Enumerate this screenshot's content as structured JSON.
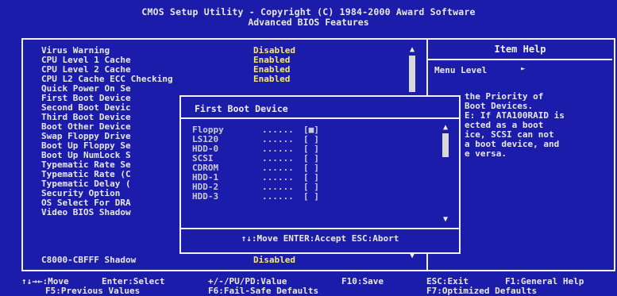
{
  "header": {
    "title": "CMOS Setup Utility - Copyright (C) 1984-2000 Award Software",
    "subtitle": "Advanced BIOS Features"
  },
  "settings": [
    {
      "name": "Virus Warning",
      "value": "Disabled"
    },
    {
      "name": "CPU Level 1 Cache",
      "value": "Enabled"
    },
    {
      "name": "CPU Level 2 Cache",
      "value": "Enabled"
    },
    {
      "name": "CPU L2 Cache ECC Checking",
      "value": "Enabled"
    },
    {
      "name": "Quick Power On Se",
      "value": ""
    },
    {
      "name": "First Boot Device",
      "value": ""
    },
    {
      "name": "Second Boot Devic",
      "value": ""
    },
    {
      "name": "Third Boot Device",
      "value": ""
    },
    {
      "name": "Boot Other Device",
      "value": ""
    },
    {
      "name": "Swap Floppy Drive",
      "value": ""
    },
    {
      "name": "Boot Up Floppy Se",
      "value": ""
    },
    {
      "name": "Boot Up NumLock S",
      "value": ""
    },
    {
      "name": "Typematic Rate Se",
      "value": ""
    },
    {
      "name": "Typematic Rate (C",
      "value": ""
    },
    {
      "name": "Typematic Delay (",
      "value": ""
    },
    {
      "name": "Security Option",
      "value": ""
    },
    {
      "name": "OS Select For DRA",
      "value": ""
    },
    {
      "name": "Video BIOS Shadow",
      "value": ""
    },
    {
      "name": "C8000-CBFFF Shadow",
      "value": "Disabled"
    }
  ],
  "item_help": {
    "title": "Item Help",
    "menu_level": "Menu Level",
    "lines": [
      "the Priority of",
      "Boot Devices.",
      "E: If ATA100RAID is",
      "ected as a boot",
      "ice, SCSI can not",
      "a boot device, and",
      "e versa."
    ]
  },
  "popup": {
    "title": "First Boot Device",
    "options": [
      {
        "name": "Floppy",
        "dots": "......",
        "box": "[■]"
      },
      {
        "name": "LS120",
        "dots": "......",
        "box": "[ ]"
      },
      {
        "name": "HDD-0",
        "dots": "......",
        "box": "[ ]"
      },
      {
        "name": "SCSI",
        "dots": "......",
        "box": "[ ]"
      },
      {
        "name": "CDROM",
        "dots": "......",
        "box": "[ ]"
      },
      {
        "name": "HDD-1",
        "dots": "......",
        "box": "[ ]"
      },
      {
        "name": "HDD-2",
        "dots": "......",
        "box": "[ ]"
      },
      {
        "name": "HDD-3",
        "dots": "......",
        "box": "[ ]"
      }
    ],
    "footer": "↑↓:Move ENTER:Accept ESC:Abort"
  },
  "footer": {
    "row1": [
      "↑↓→←:Move",
      "Enter:Select",
      "+/-/PU/PD:Value",
      "F10:Save",
      "ESC:Exit",
      "F1:General Help"
    ],
    "row2": [
      "F5:Previous Values",
      "F6:Fail-Safe Defaults",
      "F7:Optimized Defaults"
    ]
  }
}
